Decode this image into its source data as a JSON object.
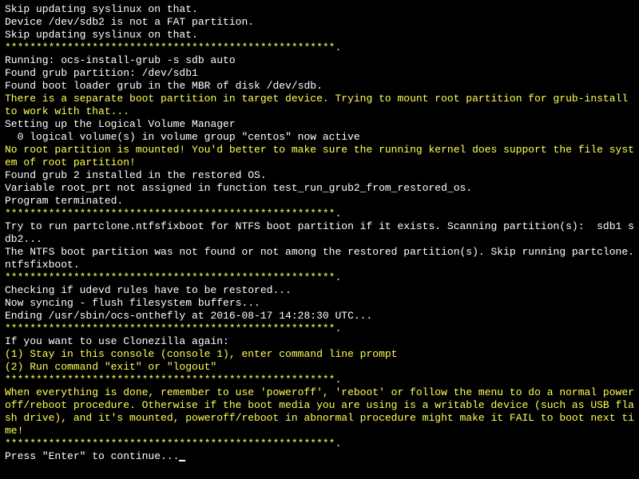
{
  "lines": [
    {
      "text": "Skip updating syslinux on that.",
      "color": "white"
    },
    {
      "text": "Device /dev/sdb2 is not a FAT partition.",
      "color": "white"
    },
    {
      "text": "Skip updating syslinux on that.",
      "color": "white"
    },
    {
      "text": "*****************************************************.",
      "color": "yellow"
    },
    {
      "text": "Running: ocs-install-grub -s sdb auto",
      "color": "white"
    },
    {
      "text": "Found grub partition: /dev/sdb1",
      "color": "white"
    },
    {
      "text": "Found boot loader grub in the MBR of disk /dev/sdb.",
      "color": "white"
    },
    {
      "text": "There is a separate boot partition in target device. Trying to mount root partition for grub-install to work with that...",
      "color": "yellow"
    },
    {
      "text": "Setting up the Logical Volume Manager",
      "color": "white"
    },
    {
      "text": "  0 logical volume(s) in volume group \"centos\" now active",
      "color": "white"
    },
    {
      "text": "No root partition is mounted! You'd better to make sure the running kernel does support the file system of root partition!",
      "color": "yellow"
    },
    {
      "text": "Found grub 2 installed in the restored OS.",
      "color": "white"
    },
    {
      "text": "Variable root_prt not assigned in function test_run_grub2_from_restored_os.",
      "color": "white"
    },
    {
      "text": "Program terminated.",
      "color": "white"
    },
    {
      "text": "*****************************************************.",
      "color": "yellow"
    },
    {
      "text": "Try to run partclone.ntfsfixboot for NTFS boot partition if it exists. Scanning partition(s):  sdb1 sdb2...",
      "color": "white"
    },
    {
      "text": "The NTFS boot partition was not found or not among the restored partition(s). Skip running partclone.ntfsfixboot.",
      "color": "white"
    },
    {
      "text": "*****************************************************.",
      "color": "yellow"
    },
    {
      "text": "Checking if udevd rules have to be restored...",
      "color": "white"
    },
    {
      "text": "Now syncing - flush filesystem buffers...",
      "color": "white"
    },
    {
      "text": "",
      "color": "white"
    },
    {
      "text": "Ending /usr/sbin/ocs-onthefly at 2016-08-17 14:28:30 UTC...",
      "color": "white"
    },
    {
      "text": "*****************************************************.",
      "color": "yellow"
    },
    {
      "text": "If you want to use Clonezilla again:",
      "color": "white"
    },
    {
      "text": "(1) Stay in this console (console 1), enter command line prompt",
      "color": "yellow"
    },
    {
      "text": "(2) Run command \"exit\" or \"logout\"",
      "color": "yellow"
    },
    {
      "text": "*****************************************************.",
      "color": "yellow"
    },
    {
      "text": "When everything is done, remember to use 'poweroff', 'reboot' or follow the menu to do a normal poweroff/reboot procedure. Otherwise if the boot media you are using is a writable device (such as USB flash drive), and it's mounted, poweroff/reboot in abnormal procedure might make it FAIL to boot next time!",
      "color": "yellow"
    },
    {
      "text": "*****************************************************.",
      "color": "yellow"
    },
    {
      "text": "Press \"Enter\" to continue...",
      "color": "white",
      "cursor": true
    }
  ]
}
